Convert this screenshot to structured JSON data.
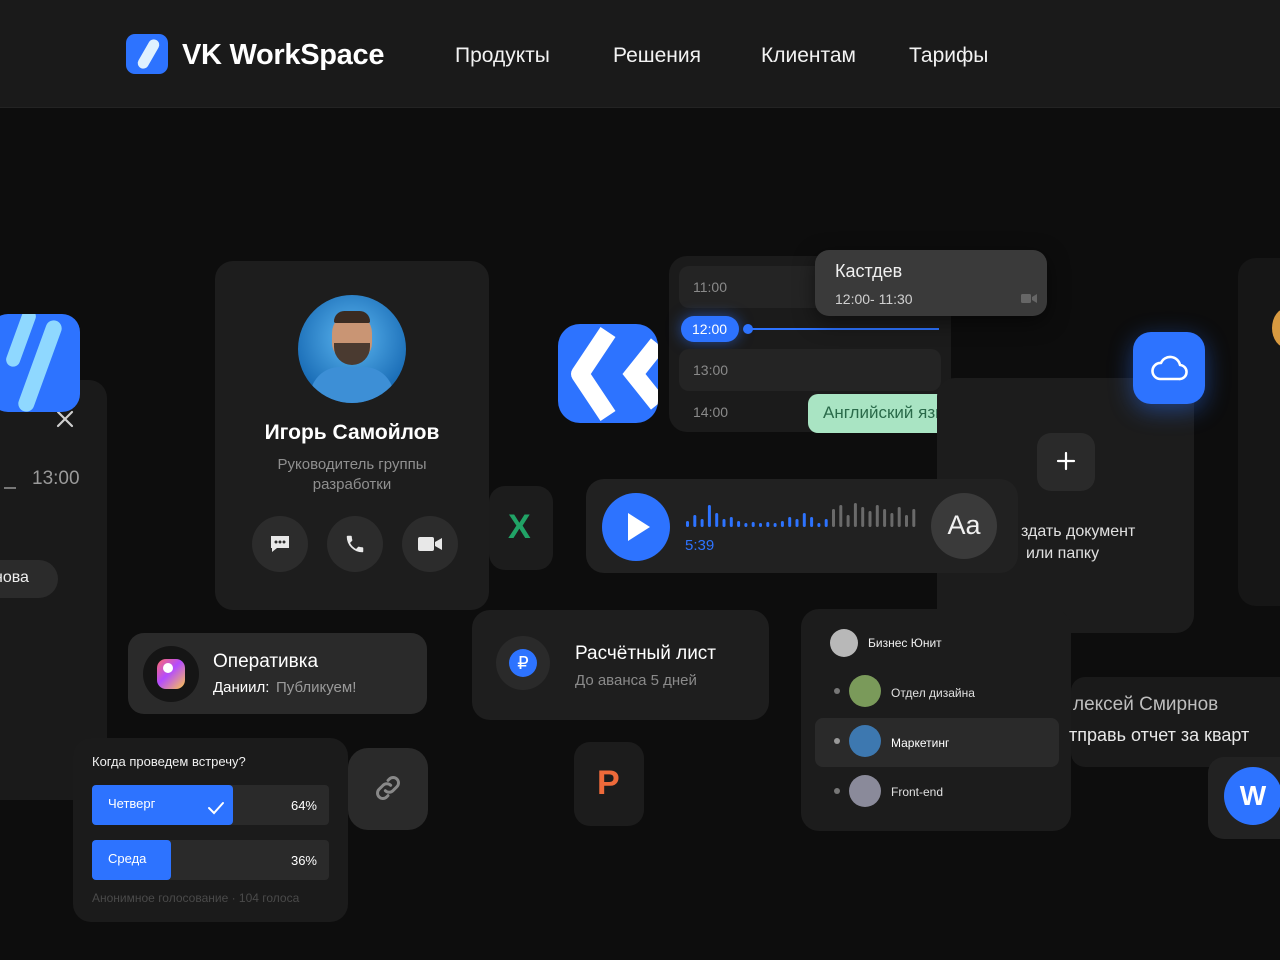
{
  "header": {
    "brand": "VK WorkSpace",
    "nav": [
      "Продукты",
      "Решения",
      "Клиентам",
      "Тарифы"
    ]
  },
  "left_card": {
    "time": "13:00",
    "chip": "нова"
  },
  "contact": {
    "name": "Игорь Самойлов",
    "role_line1": "Руководитель группы",
    "role_line2": "разработки"
  },
  "calendar": {
    "times": [
      "11:00",
      "12:00",
      "13:00",
      "14:00"
    ],
    "popup_title": "Кастдев",
    "popup_time": "12:00- 11:30",
    "event": "Английский язык"
  },
  "audio": {
    "duration": "5:39",
    "font_label": "Aa"
  },
  "excel_letter": "X",
  "upload": {
    "line1": "здать документ",
    "line2": "или папку"
  },
  "chat_preview": {
    "title": "Оперативка",
    "author": "Даниил:",
    "message": "Публикуем!"
  },
  "payslip": {
    "title": "Расчётный лист",
    "subtitle": "До аванса 5 дней",
    "currency_symbol": "₽"
  },
  "groups": {
    "items": [
      "Бизнес Юнит",
      "Отдел дизайна",
      "Маркетинг",
      "Front-end"
    ]
  },
  "message_preview": {
    "name": "лексей Смирнов",
    "text": "тправь отчет за кварт"
  },
  "word_letter": "W",
  "poll": {
    "question": "Когда проведем встречу?",
    "options": [
      {
        "label": "Четверг",
        "percent": "64%",
        "share": 0.64,
        "selected": true
      },
      {
        "label": "Среда",
        "percent": "36%",
        "share": 0.36,
        "selected": false
      }
    ],
    "footer": "Анонимное голосование · 104 голоса"
  },
  "powerpoint_letter": "P",
  "colors": {
    "accent": "#2d73ff",
    "event_green": "#a9e4c3",
    "excel_green": "#21a366",
    "ppt_orange": "#ee6a3a"
  }
}
